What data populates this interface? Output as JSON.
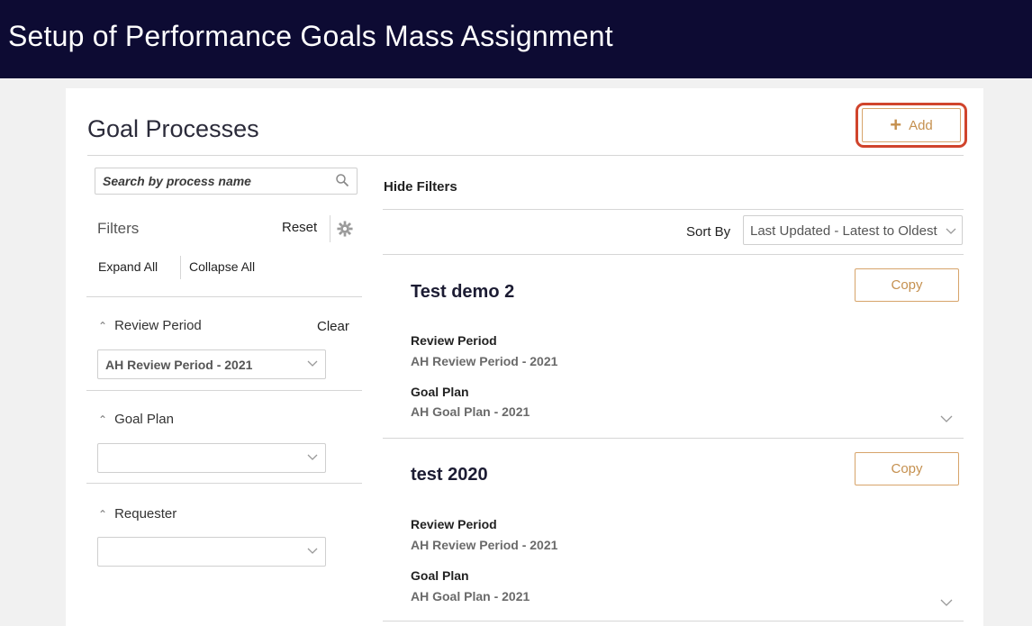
{
  "header": {
    "title": "Setup of Performance Goals Mass Assignment"
  },
  "page": {
    "title": "Goal Processes",
    "add_label": "Add"
  },
  "search": {
    "placeholder": "Search by process name"
  },
  "filters": {
    "label": "Filters",
    "reset_label": "Reset",
    "expand_all": "Expand All",
    "collapse_all": "Collapse All",
    "clear_label": "Clear",
    "facets": [
      {
        "title": "Review Period",
        "selected": "AH Review Period - 2021"
      },
      {
        "title": "Goal Plan",
        "selected": ""
      },
      {
        "title": "Requester",
        "selected": ""
      }
    ]
  },
  "results": {
    "hide_filters": "Hide Filters",
    "sort_by_label": "Sort By",
    "sort_value": "Last Updated - Latest to Oldest",
    "copy_label": "Copy",
    "items": [
      {
        "title": "Test demo 2",
        "review_period_label": "Review Period",
        "review_period": "AH Review Period - 2021",
        "goal_plan_label": "Goal Plan",
        "goal_plan": "AH Goal Plan - 2021"
      },
      {
        "title": "test 2020",
        "review_period_label": "Review Period",
        "review_period": "AH Review Period - 2021",
        "goal_plan_label": "Goal Plan",
        "goal_plan": "AH Goal Plan - 2021"
      }
    ]
  },
  "colors": {
    "header_bg": "#0d0b33",
    "accent": "#c5904f",
    "highlight": "#d0442c"
  }
}
